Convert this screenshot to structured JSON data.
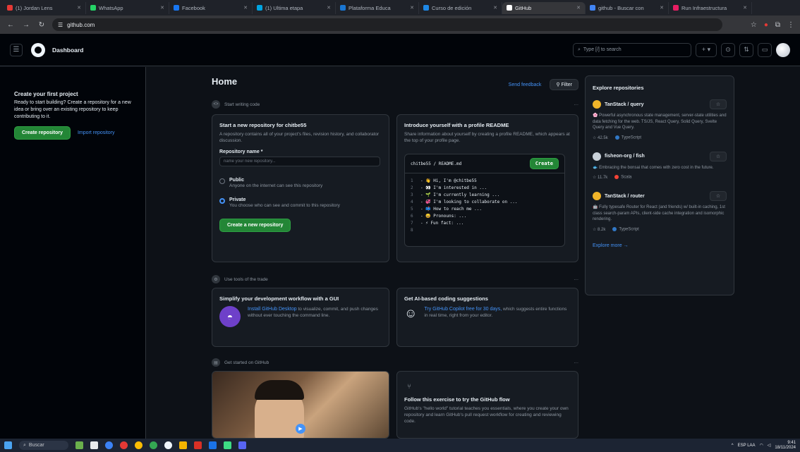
{
  "browser": {
    "tabs": [
      {
        "label": "(1) Jordan Lens",
        "color": "#e53935"
      },
      {
        "label": "WhatsApp",
        "color": "#25d366"
      },
      {
        "label": "Facebook",
        "color": "#1877f2"
      },
      {
        "label": "(1) Ultima etapa",
        "color": "#00a4e0"
      },
      {
        "label": "Plataforma Educa",
        "color": "#1976d2"
      },
      {
        "label": "Curso de edición",
        "color": "#1e88e5"
      },
      {
        "label": "GitHub",
        "color": "#ffffff",
        "active": true
      },
      {
        "label": "github - Buscar con",
        "color": "#4285f4"
      },
      {
        "label": "Run Infraestructura",
        "color": "#e91e63"
      }
    ],
    "url": "github.com"
  },
  "header": {
    "context": "Dashboard",
    "search_placeholder": "Type [/] to search",
    "icons": [
      "plus-icon",
      "issue-icon",
      "pull-request-icon",
      "inbox-icon"
    ]
  },
  "sidebar": {
    "title": "Create your first project",
    "text": "Ready to start building? Create a repository for a new idea or bring over an existing repository to keep contributing to it.",
    "create_button": "Create repository",
    "import_link": "Import repository"
  },
  "feed": {
    "title": "Home",
    "feedback_link": "Send feedback",
    "filter_button": "Filter",
    "section1_label": "Start writing code",
    "new_repo": {
      "title": "Start a new repository for chitbe55",
      "subtitle": "A repository contains all of your project's files, revision history, and collaborator discussion.",
      "name_label": "Repository name *",
      "name_placeholder": "name your new repository...",
      "public_label": "Public",
      "public_desc": "Anyone on the internet can see this repository",
      "private_label": "Private",
      "private_desc": "You choose who can see and commit to this repository",
      "create_button": "Create a new repository"
    },
    "readme": {
      "title": "Introduce yourself with a profile README",
      "subtitle": "Share information about yourself by creating a profile README, which appears at the top of your profile page.",
      "filename": "chitbe55 / README.md",
      "create_button": "Create",
      "lines": [
        "- 👋 Hi, I'm @chitbe55",
        "- 👀 I'm interested in ...",
        "- 🌱 I'm currently learning ...",
        "- 💞️ I'm looking to collaborate on ...",
        "- 📫 How to reach me ...",
        "- 😄 Pronouns: ...",
        "- ⚡ Fun fact: ...",
        ""
      ]
    },
    "section2_label": "Use tools of the trade",
    "desktop": {
      "title": "Simplify your development workflow with a GUI",
      "link": "Install GitHub Desktop",
      "text": "to visualize, commit, and push changes without ever touching the command line."
    },
    "copilot": {
      "title": "Get AI-based coding suggestions",
      "link": "Try GitHub Copilot free for 30 days,",
      "text": "which suggests entire functions in real time, right from your editor."
    },
    "section3_label": "Get started on GitHub",
    "flow": {
      "title": "Follow this exercise to try the GitHub flow",
      "text": "GitHub's \"hello world\" tutorial teaches you essentials, where you create your own repository and learn GitHub's pull request workflow for creating and reviewing code."
    }
  },
  "explore": {
    "title": "Explore repositories",
    "repos": [
      {
        "name": "TanStack / query",
        "desc": "🌸 Powerful asynchronous state management, server-state utilities and data fetching for the web. TS/JS, React Query, Solid Query, Svelte Query and Vue Query.",
        "stars": "42.5k",
        "lang": "TypeScript",
        "lang_color": "#3178c6",
        "avatar_color": "#f0b429"
      },
      {
        "name": "fisheon-org / fish",
        "desc": "🐟 Embracing the bonsai that comes with zero cost in the future.",
        "stars": "11.7k",
        "lang": "Scala",
        "lang_color": "#f44336",
        "avatar_color": "#c9d1d9"
      },
      {
        "name": "TanStack / router",
        "desc": "🤖 Fully typesafe Router for React (and friends) w/ built-in caching, 1st class search-param APIs, client-side cache integration and isomorphic rendering.",
        "stars": "8.2k",
        "lang": "TypeScript",
        "lang_color": "#3178c6",
        "avatar_color": "#f0b429"
      }
    ],
    "more_link": "Explore more →"
  },
  "taskbar": {
    "search_label": "Buscar",
    "lang": "ESP LAA",
    "time": "9:41",
    "date": "18/11/2024"
  }
}
